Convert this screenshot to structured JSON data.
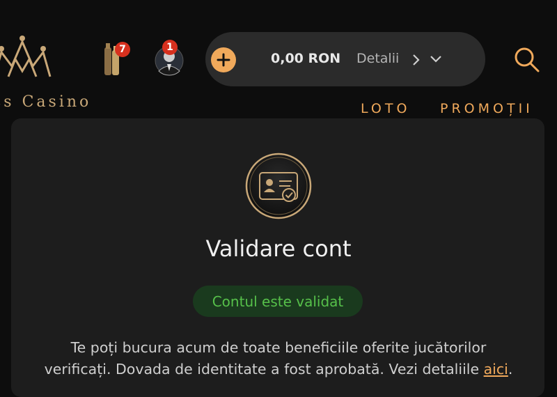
{
  "header": {
    "logo_text": "ss Casino",
    "bottles_badge": "7",
    "avatar_badge": "1",
    "wallet": {
      "balance": "0,00 RON",
      "details_label": "Detalii"
    },
    "nav": {
      "loto": "LOTO",
      "promotii": "PROMOȚII"
    }
  },
  "card": {
    "title": "Validare cont",
    "status": "Contul este validat",
    "description_line1": "Te poți bucura acum de toate beneficiile oferite jucătorilor",
    "description_line2": "verificați. Dovada de identitate a fost aprobată. Vezi detaliile",
    "link_text": "aici",
    "after_link": "."
  },
  "icons": {
    "logo": "crown-icon",
    "bottles": "bottles-icon",
    "avatar": "user-avatar-icon",
    "add": "plus-icon",
    "chevron_right": "chevron-right-icon",
    "chevron_down": "chevron-down-icon",
    "search": "search-icon",
    "id_card": "id-card-check-icon"
  },
  "colors": {
    "accent": "#f0a95b",
    "gold": "#c9a878",
    "success_text": "#56c04a",
    "success_bg": "#1a3a1e",
    "badge": "#d6301e"
  }
}
